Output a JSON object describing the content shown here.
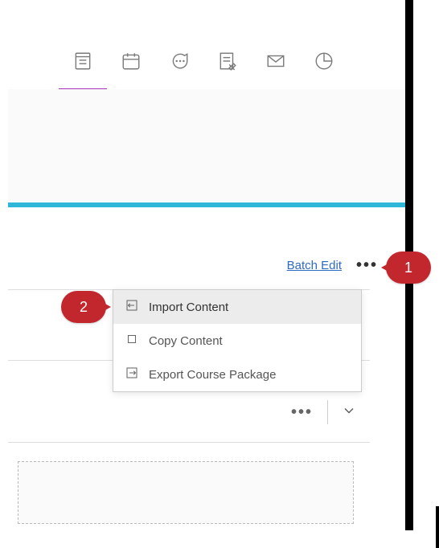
{
  "nav": {
    "tabs": [
      {
        "name": "content",
        "active": true
      },
      {
        "name": "calendar",
        "active": false
      },
      {
        "name": "discussions",
        "active": false
      },
      {
        "name": "gradebook",
        "active": false
      },
      {
        "name": "messages",
        "active": false
      },
      {
        "name": "analytics",
        "active": false
      }
    ]
  },
  "actions": {
    "batch_edit_label": "Batch Edit",
    "more_dots": "•••"
  },
  "context_menu": {
    "items": [
      {
        "label": "Import Content",
        "icon": "import-icon",
        "hover": true
      },
      {
        "label": "Copy Content",
        "icon": "copy-icon",
        "hover": false
      },
      {
        "label": "Export Course Package",
        "icon": "export-icon",
        "hover": false
      }
    ]
  },
  "row": {
    "more_dots": "•••"
  },
  "callouts": {
    "one": "1",
    "two": "2"
  }
}
